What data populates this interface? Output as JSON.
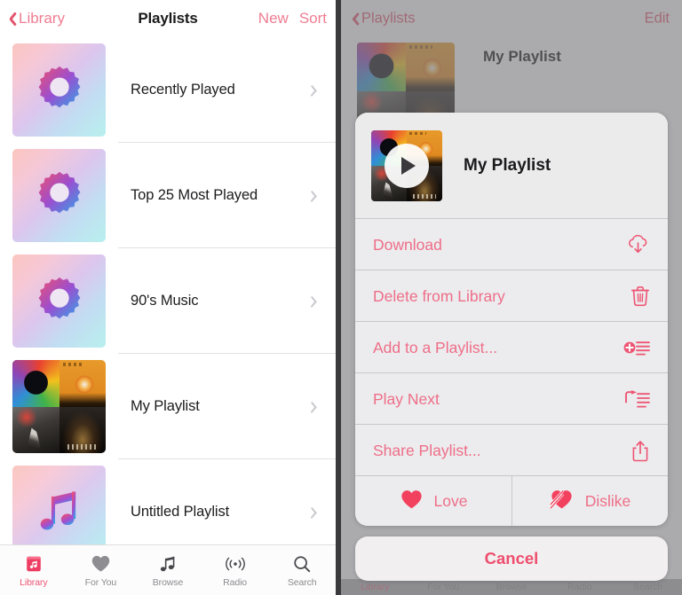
{
  "left_panel": {
    "nav": {
      "back_label": "Library",
      "back_icon": "chevron-left-icon",
      "title": "Playlists",
      "action_new": "New",
      "action_sort": "Sort"
    },
    "rows": [
      {
        "label": "Recently Played",
        "thumb": "smart-gear-gradient",
        "chevron": "chevron-right-icon"
      },
      {
        "label": "Top 25 Most Played",
        "thumb": "smart-gear-gradient",
        "chevron": "chevron-right-icon"
      },
      {
        "label": "90's Music",
        "thumb": "smart-gear-gradient",
        "chevron": "chevron-right-icon"
      },
      {
        "label": "My Playlist",
        "thumb": "album-collage",
        "chevron": "chevron-right-icon"
      },
      {
        "label": "Untitled Playlist",
        "thumb": "music-note-gradient",
        "chevron": "chevron-right-icon"
      }
    ],
    "tab_bar": {
      "active": "Library",
      "tabs": [
        {
          "label": "Library",
          "icon": "library-icon"
        },
        {
          "label": "For You",
          "icon": "heart-icon"
        },
        {
          "label": "Browse",
          "icon": "music-note-icon"
        },
        {
          "label": "Radio",
          "icon": "radio-broadcast-icon"
        },
        {
          "label": "Search",
          "icon": "search-icon"
        }
      ]
    }
  },
  "right_panel": {
    "nav": {
      "back_label": "Playlists",
      "back_icon": "chevron-left-icon",
      "edit_label": "Edit"
    },
    "background": {
      "playlist_title": "My Playlist",
      "song_title": "My Playlist"
    },
    "action_sheet": {
      "header_title": "My Playlist",
      "play_icon": "play-icon",
      "items": [
        {
          "label": "Download",
          "icon": "cloud-download-icon"
        },
        {
          "label": "Delete from Library",
          "icon": "trash-icon"
        },
        {
          "label": "Add to a Playlist...",
          "icon": "add-to-playlist-icon"
        },
        {
          "label": "Play Next",
          "icon": "play-next-icon"
        },
        {
          "label": "Share Playlist...",
          "icon": "share-icon"
        }
      ],
      "love": {
        "label": "Love",
        "icon": "heart-filled-icon"
      },
      "dislike": {
        "label": "Dislike",
        "icon": "heart-broken-icon"
      },
      "cancel_label": "Cancel"
    },
    "tab_bar": {
      "active": "Library",
      "tabs": [
        {
          "label": "Library"
        },
        {
          "label": "For You"
        },
        {
          "label": "Browse"
        },
        {
          "label": "Radio"
        },
        {
          "label": "Search"
        }
      ]
    }
  },
  "colors": {
    "accent_pink": "#ee5573",
    "menu_pink": "#ee6e88",
    "sheet_bg": "#ececee",
    "dim_overlay": "rgba(120,120,122,0.62)",
    "separator": "#e2e2e4",
    "text_primary": "#1c1c1e",
    "tab_inactive": "#8b8b90"
  }
}
